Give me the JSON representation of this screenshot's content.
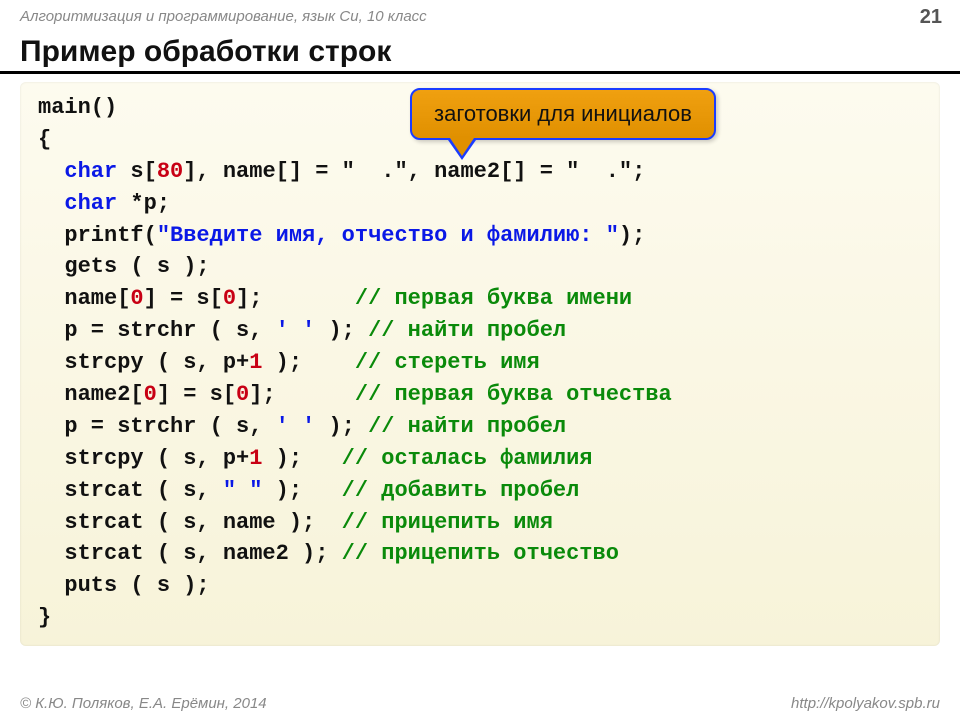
{
  "header": {
    "course": "Алгоритмизация и программирование, язык Си, 10 класс",
    "page": "21"
  },
  "title": "Пример обработки строк",
  "callout": "заготовки для инициалов",
  "code": {
    "l1": "main()",
    "l2": "{",
    "l3a": "  ",
    "l3_kw": "char",
    "l3b": " s[",
    "l3_n": "80",
    "l3c": "], name[] = \"  .\", name2[] = \"  .\";",
    "l4a": "  ",
    "l4_kw": "char",
    "l4b": " *p;",
    "l5a": "  printf(",
    "l5_str": "\"Введите имя, отчество и фамилию: \"",
    "l5b": ");",
    "l6": "  gets ( s );",
    "l7a": "  name[",
    "l7_n1": "0",
    "l7b": "] = s[",
    "l7_n2": "0",
    "l7c": "];       ",
    "l7_cm": "// первая буква имени",
    "l8a": "  p = strchr ( s, ",
    "l8_ch": "' '",
    "l8b": " ); ",
    "l8_cm": "// найти пробел",
    "l9a": "  strcpy ( s, p+",
    "l9_n": "1",
    "l9b": " );    ",
    "l9_cm": "// стереть имя",
    "l10a": "  name2[",
    "l10_n1": "0",
    "l10b": "] = s[",
    "l10_n2": "0",
    "l10c": "];      ",
    "l10_cm": "// первая буква отчества",
    "l11a": "  p = strchr ( s, ",
    "l11_ch": "' '",
    "l11b": " ); ",
    "l11_cm": "// найти пробел",
    "l12a": "  strcpy ( s, p+",
    "l12_n": "1",
    "l12b": " );   ",
    "l12_cm": "// осталась фамилия",
    "l13a": "  strcat ( s, ",
    "l13_str": "\" \"",
    "l13b": " );   ",
    "l13_cm": "// добавить пробел",
    "l14a": "  strcat ( s, name );  ",
    "l14_cm": "// прицепить имя",
    "l15a": "  strcat ( s, name2 ); ",
    "l15_cm": "// прицепить отчество",
    "l16": "  puts ( s );",
    "l17": "}"
  },
  "footer": {
    "left": "© К.Ю. Поляков, Е.А. Ерёмин, 2014",
    "right": "http://kpolyakov.spb.ru"
  }
}
